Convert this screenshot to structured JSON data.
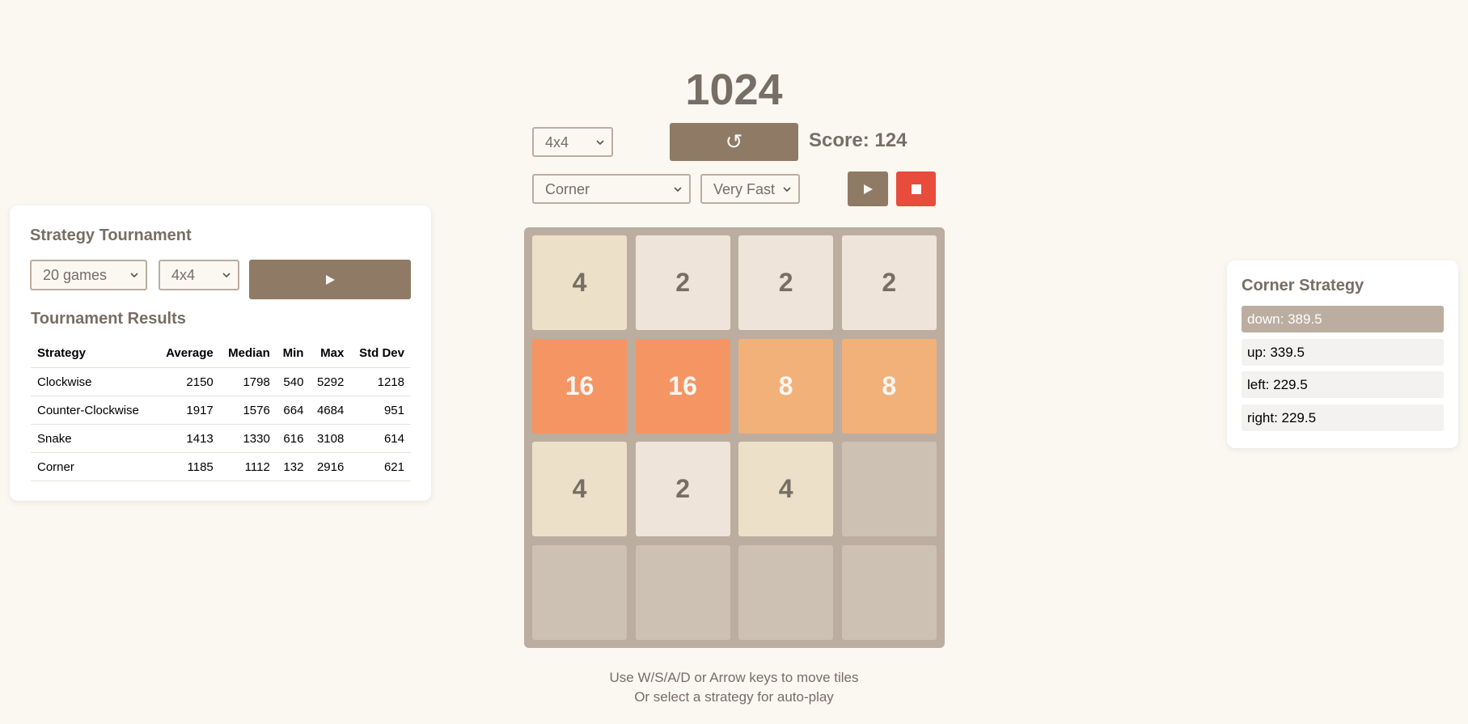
{
  "title": "1024",
  "controls": {
    "grid_size": "4x4",
    "grid_size_options": [
      "4x4"
    ],
    "score_label": "Score: 124",
    "strategy": "Corner",
    "strategy_options": [
      "Corner"
    ],
    "speed": "Very Fast",
    "speed_options": [
      "Very Fast"
    ],
    "restart_icon": "↺",
    "play_icon": "play-icon",
    "stop_icon": "stop-icon"
  },
  "board": {
    "rows": [
      [
        "4",
        "2",
        "2",
        "2"
      ],
      [
        "16",
        "16",
        "8",
        "8"
      ],
      [
        "4",
        "2",
        "4",
        ""
      ],
      [
        "",
        "",
        "",
        ""
      ]
    ],
    "colors": {
      "empty": "#cdc1b4",
      "2": "#eee4da",
      "4": "#ede0c8",
      "8": "#f2b179",
      "16": "#f59563"
    }
  },
  "instructions": {
    "line1": "Use W/S/A/D or Arrow keys to move tiles",
    "line2": "Or select a strategy for auto-play"
  },
  "tournament": {
    "title": "Strategy Tournament",
    "games": "20 games",
    "games_options": [
      "20 games"
    ],
    "size": "4x4",
    "size_options": [
      "4x4"
    ],
    "results_title": "Tournament Results",
    "headers": [
      "Strategy",
      "Average",
      "Median",
      "Min",
      "Max",
      "Std Dev"
    ],
    "rows": [
      [
        "Clockwise",
        "2150",
        "1798",
        "540",
        "5292",
        "1218"
      ],
      [
        "Counter-Clockwise",
        "1917",
        "1576",
        "664",
        "4684",
        "951"
      ],
      [
        "Snake",
        "1413",
        "1330",
        "616",
        "3108",
        "614"
      ],
      [
        "Corner",
        "1185",
        "1112",
        "132",
        "2916",
        "621"
      ]
    ]
  },
  "strategy_panel": {
    "title": "Corner Strategy",
    "moves": [
      {
        "label": "down: 389.5",
        "best": true
      },
      {
        "label": "up: 339.5",
        "best": false
      },
      {
        "label": "left: 229.5",
        "best": false
      },
      {
        "label": "right: 229.5",
        "best": false
      }
    ]
  },
  "colors": {
    "accent": "#8f7a66",
    "stop": "#e74c3c",
    "board": "#bbada0",
    "background": "#faf8f1"
  }
}
